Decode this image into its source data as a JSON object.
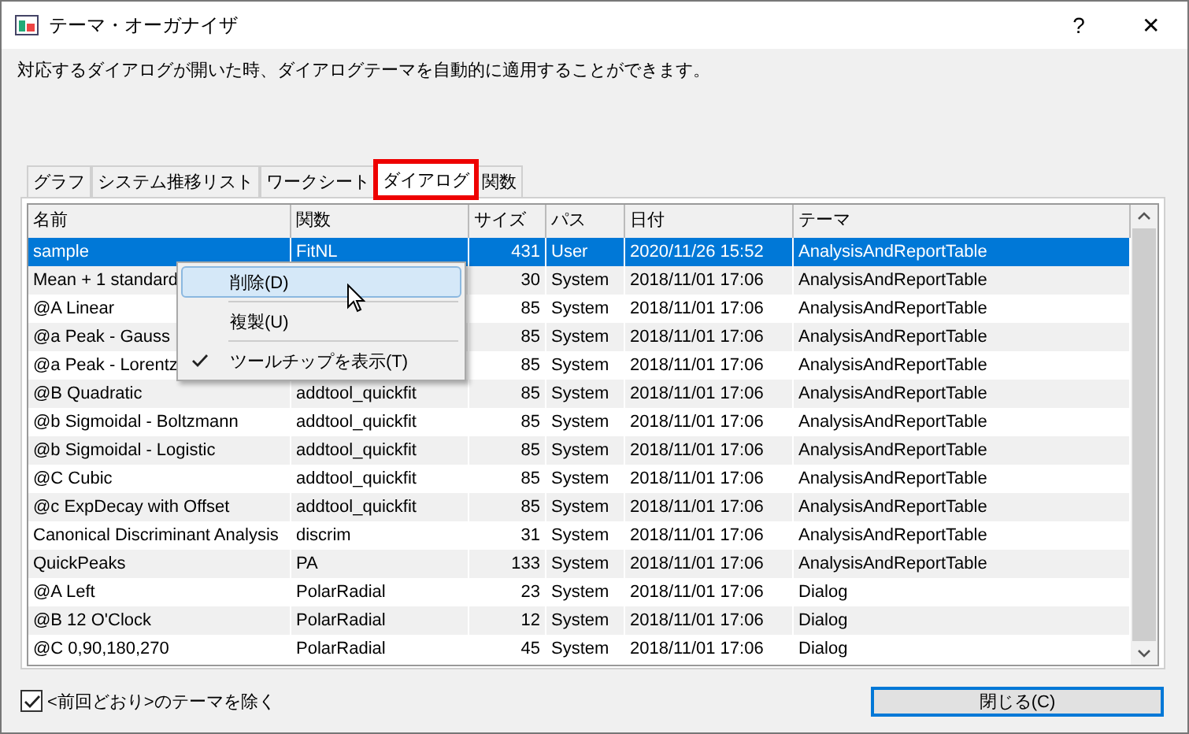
{
  "window": {
    "title": "テーマ・オーガナイザ",
    "help": "?",
    "close": "✕"
  },
  "description": "対応するダイアログが開いた時、ダイアログテーマを自動的に適用することができます。",
  "tabs": [
    {
      "label": "グラフ",
      "selected": false,
      "highlighted": false
    },
    {
      "label": "システム推移リスト",
      "selected": false,
      "highlighted": false
    },
    {
      "label": "ワークシート",
      "selected": false,
      "highlighted": false
    },
    {
      "label": "ダイアログ",
      "selected": true,
      "highlighted": true
    },
    {
      "label": "関数",
      "selected": false,
      "highlighted": false
    }
  ],
  "table": {
    "columns": [
      "名前",
      "関数",
      "サイズ",
      "パス",
      "日付",
      "テーマ"
    ],
    "rows": [
      {
        "selected": true,
        "name": "sample",
        "function": "FitNL",
        "size": "431",
        "path": "User",
        "date": "2020/11/26 15:52",
        "theme": "AnalysisAndReportTable"
      },
      {
        "selected": false,
        "name": "Mean + 1 standard",
        "size": "30",
        "path": "System",
        "date": "2018/11/01 17:06",
        "theme": "AnalysisAndReportTable"
      },
      {
        "selected": false,
        "name": "@A Linear",
        "size": "85",
        "path": "System",
        "date": "2018/11/01 17:06",
        "theme": "AnalysisAndReportTable"
      },
      {
        "selected": false,
        "name": "@a Peak - Gauss",
        "size": "85",
        "path": "System",
        "date": "2018/11/01 17:06",
        "theme": "AnalysisAndReportTable"
      },
      {
        "selected": false,
        "name": "@a Peak - Lorentz",
        "size": "85",
        "path": "System",
        "date": "2018/11/01 17:06",
        "theme": "AnalysisAndReportTable"
      },
      {
        "selected": false,
        "name": "@B Quadratic",
        "function": "addtool_quickfit",
        "size": "85",
        "path": "System",
        "date": "2018/11/01 17:06",
        "theme": "AnalysisAndReportTable"
      },
      {
        "selected": false,
        "name": "@b Sigmoidal - Boltzmann",
        "function": "addtool_quickfit",
        "size": "85",
        "path": "System",
        "date": "2018/11/01 17:06",
        "theme": "AnalysisAndReportTable"
      },
      {
        "selected": false,
        "name": "@b Sigmoidal - Logistic",
        "function": "addtool_quickfit",
        "size": "85",
        "path": "System",
        "date": "2018/11/01 17:06",
        "theme": "AnalysisAndReportTable"
      },
      {
        "selected": false,
        "name": "@C Cubic",
        "function": "addtool_quickfit",
        "size": "85",
        "path": "System",
        "date": "2018/11/01 17:06",
        "theme": "AnalysisAndReportTable"
      },
      {
        "selected": false,
        "name": "@c ExpDecay with Offset",
        "function": "addtool_quickfit",
        "size": "85",
        "path": "System",
        "date": "2018/11/01 17:06",
        "theme": "AnalysisAndReportTable"
      },
      {
        "selected": false,
        "name": "Canonical Discriminant Analysis",
        "function": "discrim",
        "size": "31",
        "path": "System",
        "date": "2018/11/01 17:06",
        "theme": "AnalysisAndReportTable"
      },
      {
        "selected": false,
        "name": "QuickPeaks",
        "function": "PA",
        "size": "133",
        "path": "System",
        "date": "2018/11/01 17:06",
        "theme": "AnalysisAndReportTable"
      },
      {
        "selected": false,
        "name": "@A Left",
        "function": "PolarRadial",
        "size": "23",
        "path": "System",
        "date": "2018/11/01 17:06",
        "theme": "Dialog"
      },
      {
        "selected": false,
        "name": "@B 12 O'Clock",
        "function": "PolarRadial",
        "size": "12",
        "path": "System",
        "date": "2018/11/01 17:06",
        "theme": "Dialog"
      },
      {
        "selected": false,
        "name": "@C 0,90,180,270",
        "function": "PolarRadial",
        "size": "45",
        "path": "System",
        "date": "2018/11/01 17:06",
        "theme": "Dialog"
      }
    ]
  },
  "context_menu": [
    {
      "kind": "item",
      "label": "削除(D)",
      "selected": true,
      "checked": false
    },
    {
      "kind": "separator"
    },
    {
      "kind": "item",
      "label": "複製(U)",
      "selected": false,
      "checked": false
    },
    {
      "kind": "separator"
    },
    {
      "kind": "item",
      "label": "ツールチップを表示(T)",
      "selected": false,
      "checked": true
    }
  ],
  "exclude_checkbox": {
    "label": "<前回どおり>のテーマを除く",
    "checked": true
  },
  "close_button": "閉じる(C)"
}
